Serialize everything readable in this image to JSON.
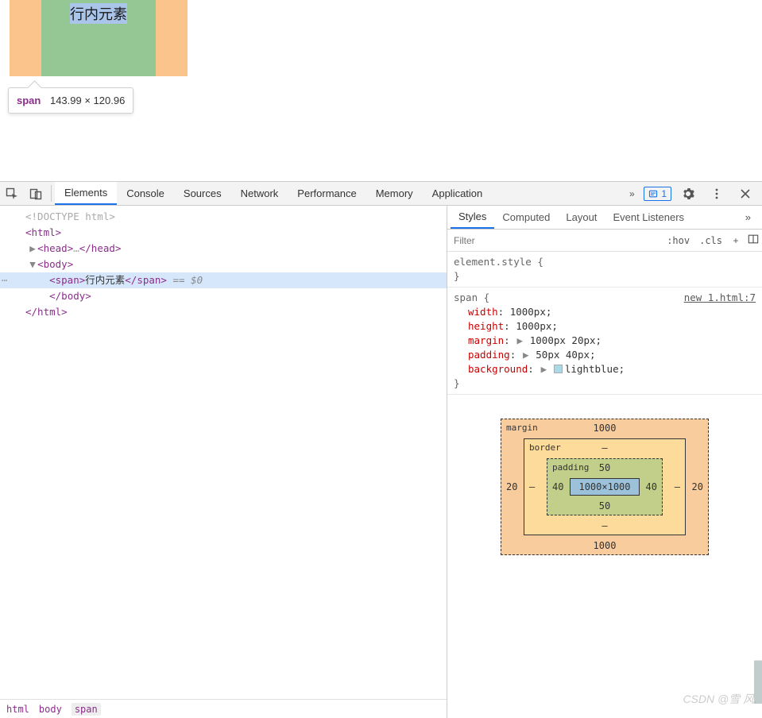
{
  "viewport": {
    "span_text": "行内元素",
    "tooltip": {
      "tag": "span",
      "dims": "143.99 × 120.96"
    }
  },
  "toolbar": {
    "tabs": [
      "Elements",
      "Console",
      "Sources",
      "Network",
      "Performance",
      "Memory",
      "Application"
    ],
    "active_tab": "Elements",
    "issues_count": "1"
  },
  "dom": {
    "lines": [
      {
        "indent": 0,
        "pre": "",
        "html": "<span class='t-doctype'>&lt;!DOCTYPE html&gt;</span>"
      },
      {
        "indent": 0,
        "pre": "",
        "html": "<span class='t-tag'>&lt;html&gt;</span>"
      },
      {
        "indent": 1,
        "pre": "▶",
        "html": "<span class='t-tag'>&lt;head&gt;</span><span class='t-doctype'>…</span><span class='t-tag'>&lt;/head&gt;</span>"
      },
      {
        "indent": 1,
        "pre": "▼",
        "html": "<span class='t-tag'>&lt;body&gt;</span>"
      },
      {
        "indent": 2,
        "pre": "",
        "sel": true,
        "html": "<span class='t-tag'>&lt;span&gt;</span><span class='t-text'>行内元素</span><span class='t-tag'>&lt;/span&gt;</span> <span class='t-eq'>== $0</span>"
      },
      {
        "indent": 1,
        "pre": "",
        "html": "  <span class='t-tag'>&lt;/body&gt;</span>"
      },
      {
        "indent": 0,
        "pre": "",
        "html": "<span class='t-tag'>&lt;/html&gt;</span>"
      }
    ],
    "breadcrumbs": [
      "html",
      "body",
      "span"
    ]
  },
  "styles": {
    "tabs": [
      "Styles",
      "Computed",
      "Layout",
      "Event Listeners"
    ],
    "active_tab": "Styles",
    "filter_placeholder": "Filter",
    "actions": {
      "hov": ":hov",
      "cls": ".cls"
    },
    "rules": [
      {
        "selector": "element.style",
        "brace_open": " {",
        "decls": [],
        "src": ""
      },
      {
        "selector": "span",
        "brace_open": " {",
        "src": "new 1.html:7",
        "decls": [
          {
            "prop": "width",
            "expand": "",
            "val": "1000px",
            "swatch": ""
          },
          {
            "prop": "height",
            "expand": "",
            "val": "1000px",
            "swatch": ""
          },
          {
            "prop": "margin",
            "expand": "▶",
            "val": "1000px 20px",
            "swatch": ""
          },
          {
            "prop": "padding",
            "expand": "▶",
            "val": "50px 40px",
            "swatch": ""
          },
          {
            "prop": "background",
            "expand": "▶",
            "val": "lightblue",
            "swatch": "#add8e6"
          }
        ]
      }
    ]
  },
  "boxmodel": {
    "margin": {
      "label": "margin",
      "t": "1000",
      "r": "20",
      "b": "1000",
      "l": "20"
    },
    "border": {
      "label": "border",
      "t": "–",
      "r": "–",
      "b": "–",
      "l": "–"
    },
    "padding": {
      "label": "padding",
      "t": "50",
      "r": "40",
      "b": "50",
      "l": "40"
    },
    "content": "1000×1000"
  },
  "watermark": "CSDN @雪 风."
}
